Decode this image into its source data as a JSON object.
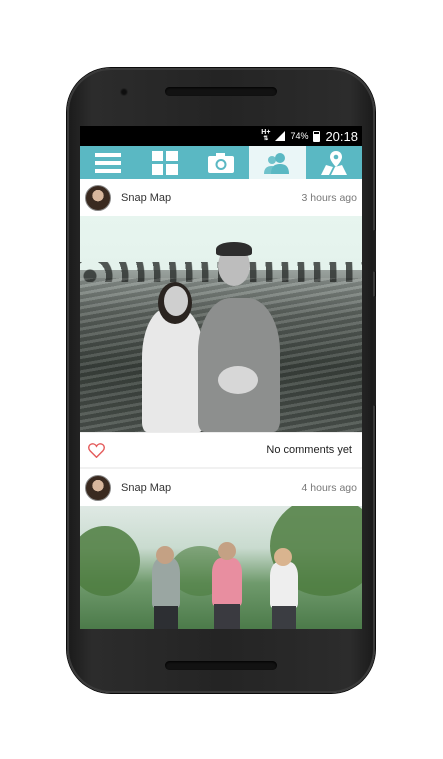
{
  "status_bar": {
    "network": "H+",
    "battery": "74%",
    "time": "20:18"
  },
  "nav": {
    "tabs": [
      {
        "icon": "menu-icon"
      },
      {
        "icon": "grid-icon"
      },
      {
        "icon": "camera-icon"
      },
      {
        "icon": "friends-icon",
        "active": true
      },
      {
        "icon": "map-pin-icon"
      }
    ],
    "accent_color": "#5ab8c3"
  },
  "feed": {
    "posts": [
      {
        "user": "Snap Map",
        "time": "3 hours ago",
        "comments": "No comments yet",
        "liked": false
      },
      {
        "user": "Snap Map",
        "time": "4 hours ago"
      }
    ]
  }
}
